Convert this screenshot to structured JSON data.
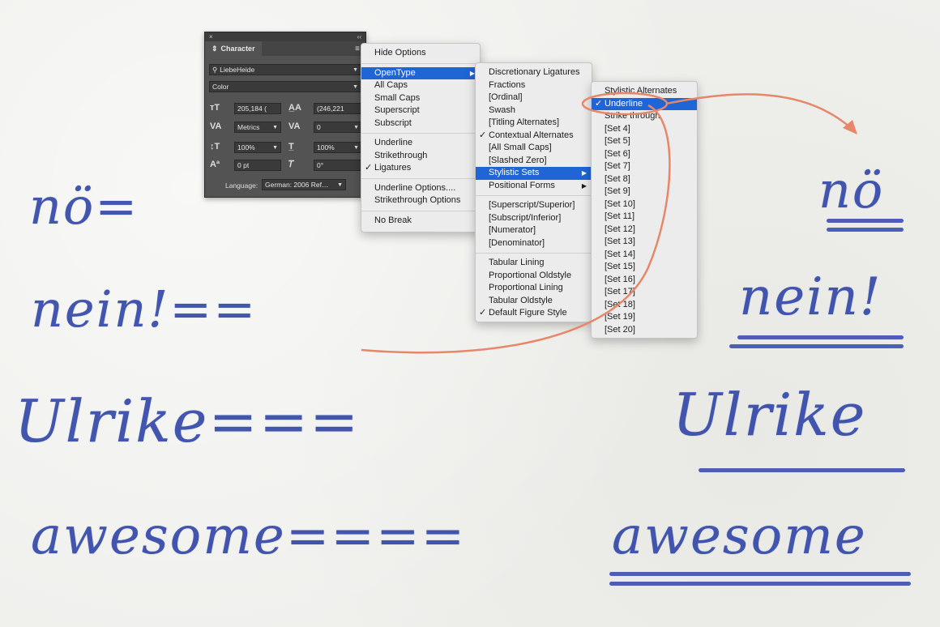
{
  "canvas_text": {
    "left": [
      "nö=",
      "nein!==",
      "Ulrike===",
      "awesome===="
    ],
    "right": [
      "nö",
      "nein!",
      "Ulrike",
      "awesome"
    ]
  },
  "character_panel": {
    "close": "×",
    "collapse": "‹‹",
    "tab": "Character",
    "font_family": "LiebeHeide",
    "font_style": "Color",
    "font_size": "205,184 (",
    "leading": "(246,221",
    "kerning": "Metrics",
    "tracking": "0",
    "vertical_scale": "100%",
    "horizontal_scale": "100%",
    "baseline_shift": "0 pt",
    "skew": "0°",
    "language_label": "Language:",
    "language": "German: 2006 Ref…"
  },
  "menu1": {
    "items": [
      "Hide Options",
      "OpenType",
      "All Caps",
      "Small Caps",
      "Superscript",
      "Subscript",
      "Underline",
      "Strikethrough",
      "Ligatures",
      "Underline Options....",
      "Strikethrough Options",
      "No Break"
    ],
    "selected": "OpenType",
    "checked": "Ligatures"
  },
  "menu2": {
    "items": [
      "Discretionary Ligatures",
      "Fractions",
      "[Ordinal]",
      "Swash",
      "[Titling Alternates]",
      "Contextual Alternates",
      "[All Small Caps]",
      "[Slashed Zero]",
      "Stylistic Sets",
      "Positional Forms",
      "[Superscript/Superior]",
      "[Subscript/Inferior]",
      "[Numerator]",
      "[Denominator]",
      "Tabular Lining",
      "Proportional Oldstyle",
      "Proportional Lining",
      "Tabular Oldstyle",
      "Default Figure Style"
    ],
    "selected": "Stylistic Sets",
    "checked": [
      "Contextual Alternates",
      "Default Figure Style"
    ]
  },
  "menu3": {
    "items": [
      "Stylistic Alternates",
      "Underline",
      "Strike through",
      "[Set 4]",
      "[Set 5]",
      "[Set 6]",
      "[Set 7]",
      "[Set 8]",
      "[Set 9]",
      "[Set 10]",
      "[Set 11]",
      "[Set 12]",
      "[Set 13]",
      "[Set 14]",
      "[Set 15]",
      "[Set 16]",
      "[Set 17]",
      "[Set 18]",
      "[Set 19]",
      "[Set 20]"
    ],
    "selected": "Underline",
    "checked": "Underline"
  },
  "colors": {
    "ink": "#2f44a8",
    "highlight": "#1f65d6",
    "annotation": "#e8866a"
  }
}
